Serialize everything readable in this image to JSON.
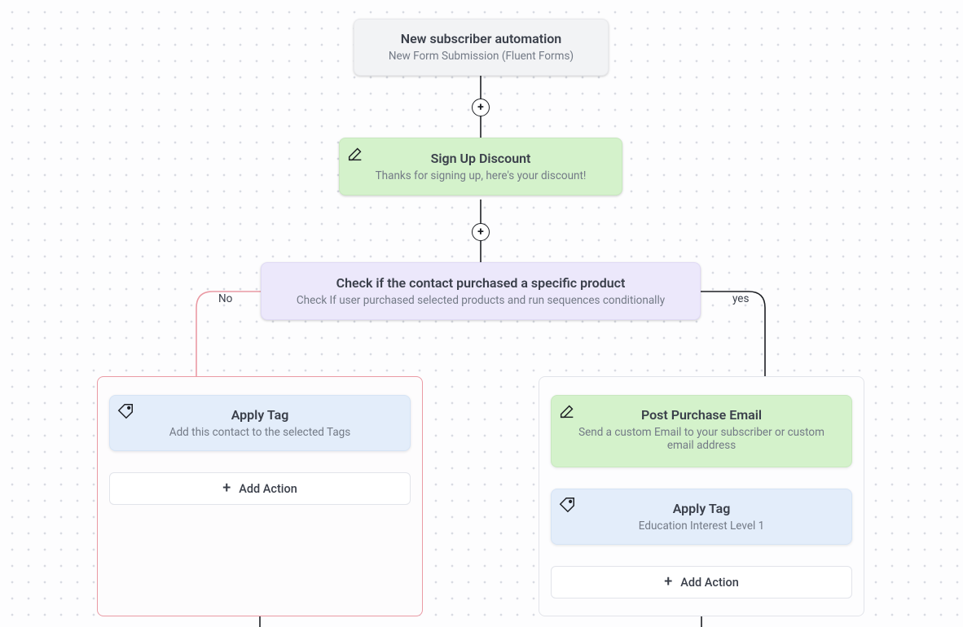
{
  "trigger": {
    "title": "New subscriber automation",
    "subtitle": "New Form Submission (Fluent Forms)"
  },
  "email1": {
    "title": "Sign Up Discount",
    "subtitle": "Thanks for signing up, here's your discount!"
  },
  "conditional": {
    "title": "Check if the contact purchased a specific product",
    "subtitle": "Check If user purchased selected products and run sequences conditionally"
  },
  "labels": {
    "no": "No",
    "yes": "yes",
    "add_action": "Add Action"
  },
  "no_branch": {
    "apply_tag": {
      "title": "Apply Tag",
      "subtitle": "Add this contact to the selected Tags"
    }
  },
  "yes_branch": {
    "email": {
      "title": "Post Purchase Email",
      "subtitle": "Send a custom Email to your subscriber or custom email address"
    },
    "apply_tag": {
      "title": "Apply Tag",
      "subtitle": "Education Interest Level 1"
    }
  }
}
